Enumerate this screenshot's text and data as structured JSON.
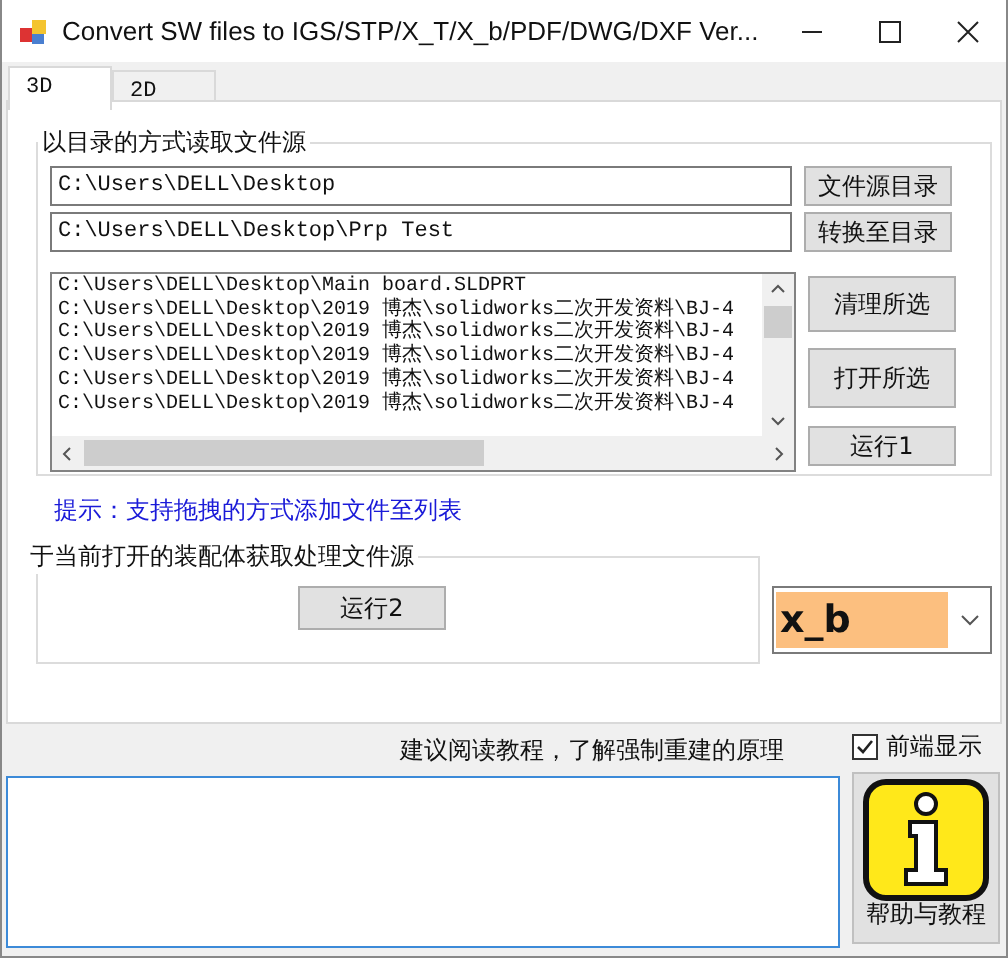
{
  "window": {
    "title": "Convert SW files to IGS/STP/X_T/X_b/PDF/DWG/DXF Ver..."
  },
  "tabs": [
    {
      "label": "3D",
      "selected": true
    },
    {
      "label": "2D",
      "selected": false
    }
  ],
  "directory_group": {
    "title": "以目录的方式读取文件源",
    "source_path": "C:\\Users\\DELL\\Desktop",
    "source_button": "文件源目录",
    "target_path": "C:\\Users\\DELL\\Desktop\\Prp Test",
    "target_button": "转换至目录",
    "files": [
      "C:\\Users\\DELL\\Desktop\\Main board.SLDPRT",
      "C:\\Users\\DELL\\Desktop\\2019 博杰\\solidworks二次开发资料\\BJ-4",
      "C:\\Users\\DELL\\Desktop\\2019 博杰\\solidworks二次开发资料\\BJ-4",
      "C:\\Users\\DELL\\Desktop\\2019 博杰\\solidworks二次开发资料\\BJ-4",
      "C:\\Users\\DELL\\Desktop\\2019 博杰\\solidworks二次开发资料\\BJ-4",
      "C:\\Users\\DELL\\Desktop\\2019 博杰\\solidworks二次开发资料\\BJ-4"
    ],
    "list_buttons": [
      "清理所选",
      "打开所选",
      "运行1"
    ]
  },
  "hint": "提示：支持拖拽的方式添加文件至列表",
  "assembly_group": {
    "title": "于当前打开的装配体获取处理文件源",
    "button": "运行2"
  },
  "format_select": {
    "value": "x_b"
  },
  "tutorial_note": "建议阅读教程，了解强制重建的原理",
  "topmost": {
    "label": "前端显示",
    "checked": true
  },
  "help_button": "帮助与教程"
}
